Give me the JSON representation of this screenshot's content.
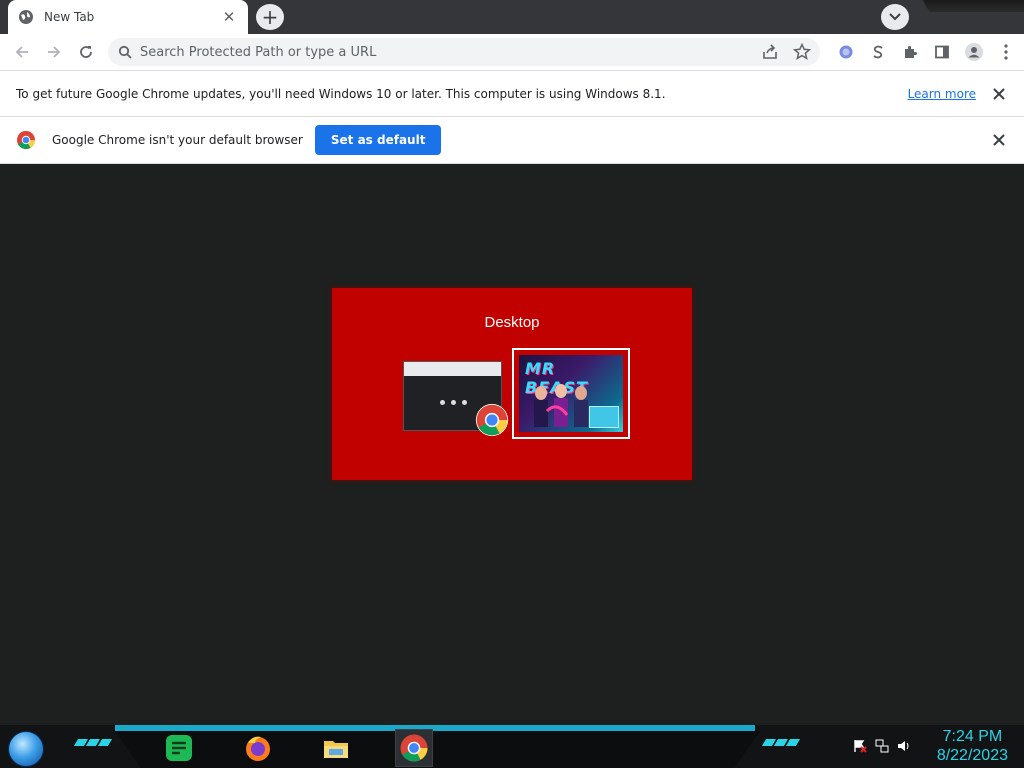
{
  "tabs": [
    {
      "title": "New Tab",
      "close_glyph": "✕"
    }
  ],
  "new_tab_glyph": "+",
  "omnibox": {
    "placeholder": "Search Protected Path or type a URL"
  },
  "infobar_update": {
    "message": "To get future Google Chrome updates, you'll need Windows 10 or later. This computer is using Windows 8.1.",
    "link": "Learn more"
  },
  "infobar_default": {
    "message": "Google Chrome isn't your default browser",
    "button": "Set as default"
  },
  "task_switcher": {
    "title": "Desktop",
    "thumb_text": "MR BEAST"
  },
  "clock": {
    "time": "7:24 PM",
    "date": "8/22/2023"
  },
  "colors": {
    "accent": "#1a73e8",
    "switcher_bg": "#c10000",
    "taskbar_accent": "#2ad3e6"
  }
}
